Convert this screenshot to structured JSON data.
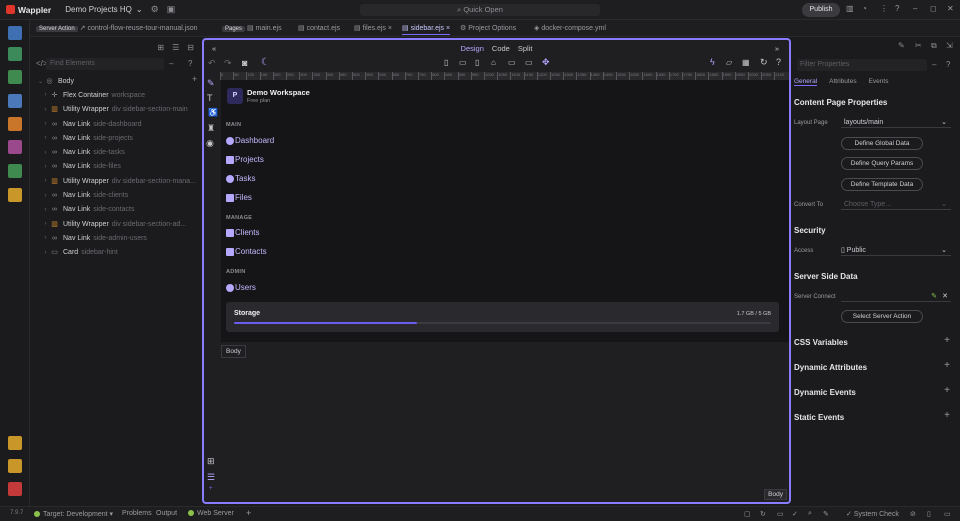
{
  "app": {
    "name": "Wappler",
    "project": "Demo Projects HQ"
  },
  "topbar": {
    "quick_open": "Quick Open",
    "publish": "Publish"
  },
  "tabs": [
    {
      "label": "control-flow-reuse-tour-manual.json",
      "badge": "Server Action"
    },
    {
      "label": "main.ejs",
      "badge": "Pages"
    },
    {
      "label": "contact.ejs"
    },
    {
      "label": "files.ejs"
    },
    {
      "label": "sidebar.ejs",
      "active": true
    },
    {
      "label": "Project Options"
    },
    {
      "label": "docker-compose.yml"
    }
  ],
  "left_panel": {
    "find_placeholder": "Find Elements",
    "tree": [
      {
        "name": "Body",
        "cls": "",
        "icon": "body-icon",
        "depth": 0
      },
      {
        "name": "Flex Container",
        "cls": "workspace",
        "icon": "flex-icon",
        "depth": 1
      },
      {
        "name": "Utility Wrapper",
        "cls": "div sidebar-section-main",
        "icon": "wrapper-icon",
        "depth": 1
      },
      {
        "name": "Nav Link",
        "cls": "side-dashboard",
        "icon": "link-icon",
        "depth": 1
      },
      {
        "name": "Nav Link",
        "cls": "side-projects",
        "icon": "link-icon",
        "depth": 1
      },
      {
        "name": "Nav Link",
        "cls": "side-tasks",
        "icon": "link-icon",
        "depth": 1
      },
      {
        "name": "Nav Link",
        "cls": "side-files",
        "icon": "link-icon",
        "depth": 1
      },
      {
        "name": "Utility Wrapper",
        "cls": "div sidebar-section-mana...",
        "icon": "wrapper-icon",
        "depth": 1
      },
      {
        "name": "Nav Link",
        "cls": "side-clients",
        "icon": "link-icon",
        "depth": 1
      },
      {
        "name": "Nav Link",
        "cls": "side-contacts",
        "icon": "link-icon",
        "depth": 1
      },
      {
        "name": "Utility Wrapper",
        "cls": "div sidebar-section-ad...",
        "icon": "wrapper-icon",
        "depth": 1
      },
      {
        "name": "Nav Link",
        "cls": "side-admin-users",
        "icon": "link-icon",
        "depth": 1
      },
      {
        "name": "Card",
        "cls": "sidebar-hint",
        "icon": "card-icon",
        "depth": 1
      }
    ]
  },
  "canvas": {
    "modes": {
      "design": "Design",
      "code": "Code",
      "split": "Split"
    },
    "ruler_ticks": [
      "0",
      "50",
      "100",
      "150",
      "200",
      "250",
      "300",
      "350",
      "400",
      "450",
      "500",
      "550",
      "600",
      "650",
      "700",
      "750",
      "800",
      "850",
      "900",
      "950",
      "1000",
      "1050",
      "1100",
      "1150",
      "1200",
      "1250",
      "1300",
      "1350",
      "1400",
      "1450",
      "1500",
      "1550",
      "1600",
      "1650",
      "1700",
      "1750",
      "1800",
      "1850",
      "1900",
      "1950",
      "2000",
      "2050",
      "2100"
    ],
    "workspace": {
      "logo": "P",
      "name": "Demo Workspace",
      "plan": "Free plan"
    },
    "sections": {
      "main": "MAIN",
      "manage": "MANAGE",
      "admin": "ADMIN"
    },
    "nav": {
      "dashboard": "Dashboard",
      "projects": "Projects",
      "tasks": "Tasks",
      "files": "Files",
      "clients": "Clients",
      "contacts": "Contacts",
      "users": "Users"
    },
    "storage": {
      "label": "Storage",
      "value": "1.7 GB / 5 GB",
      "fraction": 0.34
    },
    "body_tag": "Body",
    "body_tag_bottom": "Body"
  },
  "right_panel": {
    "search_placeholder": "Filter Properties",
    "tabs": {
      "general": "General",
      "attributes": "Attributes",
      "events": "Events"
    },
    "content_page_title": "Content Page Properties",
    "layout_page_label": "Layout Page",
    "layout_page_value": "layouts/main",
    "btn_global": "Define Global Data",
    "btn_query": "Define Query Params",
    "btn_template": "Define Template Data",
    "convert_label": "Convert To",
    "convert_placeholder": "Choose Type...",
    "security_title": "Security",
    "access_label": "Access",
    "access_value": "Public",
    "ssd_title": "Server Side Data",
    "server_connect_label": "Server Connect",
    "btn_select_action": "Select Server Action",
    "css_vars": "CSS Variables",
    "dyn_attrs": "Dynamic Attributes",
    "dyn_events": "Dynamic Events",
    "static_events": "Static Events"
  },
  "statusbar": {
    "version": "7.9.7",
    "target": "Target: Development",
    "problems": "Problems",
    "output": "Output",
    "web_server": "Web Server",
    "system_check": "System Check"
  },
  "colors": {
    "accent": "#8a7cff",
    "brand": "#e0352b",
    "nav_text": "#c4b8ff",
    "progress": "#6a5cf0"
  }
}
